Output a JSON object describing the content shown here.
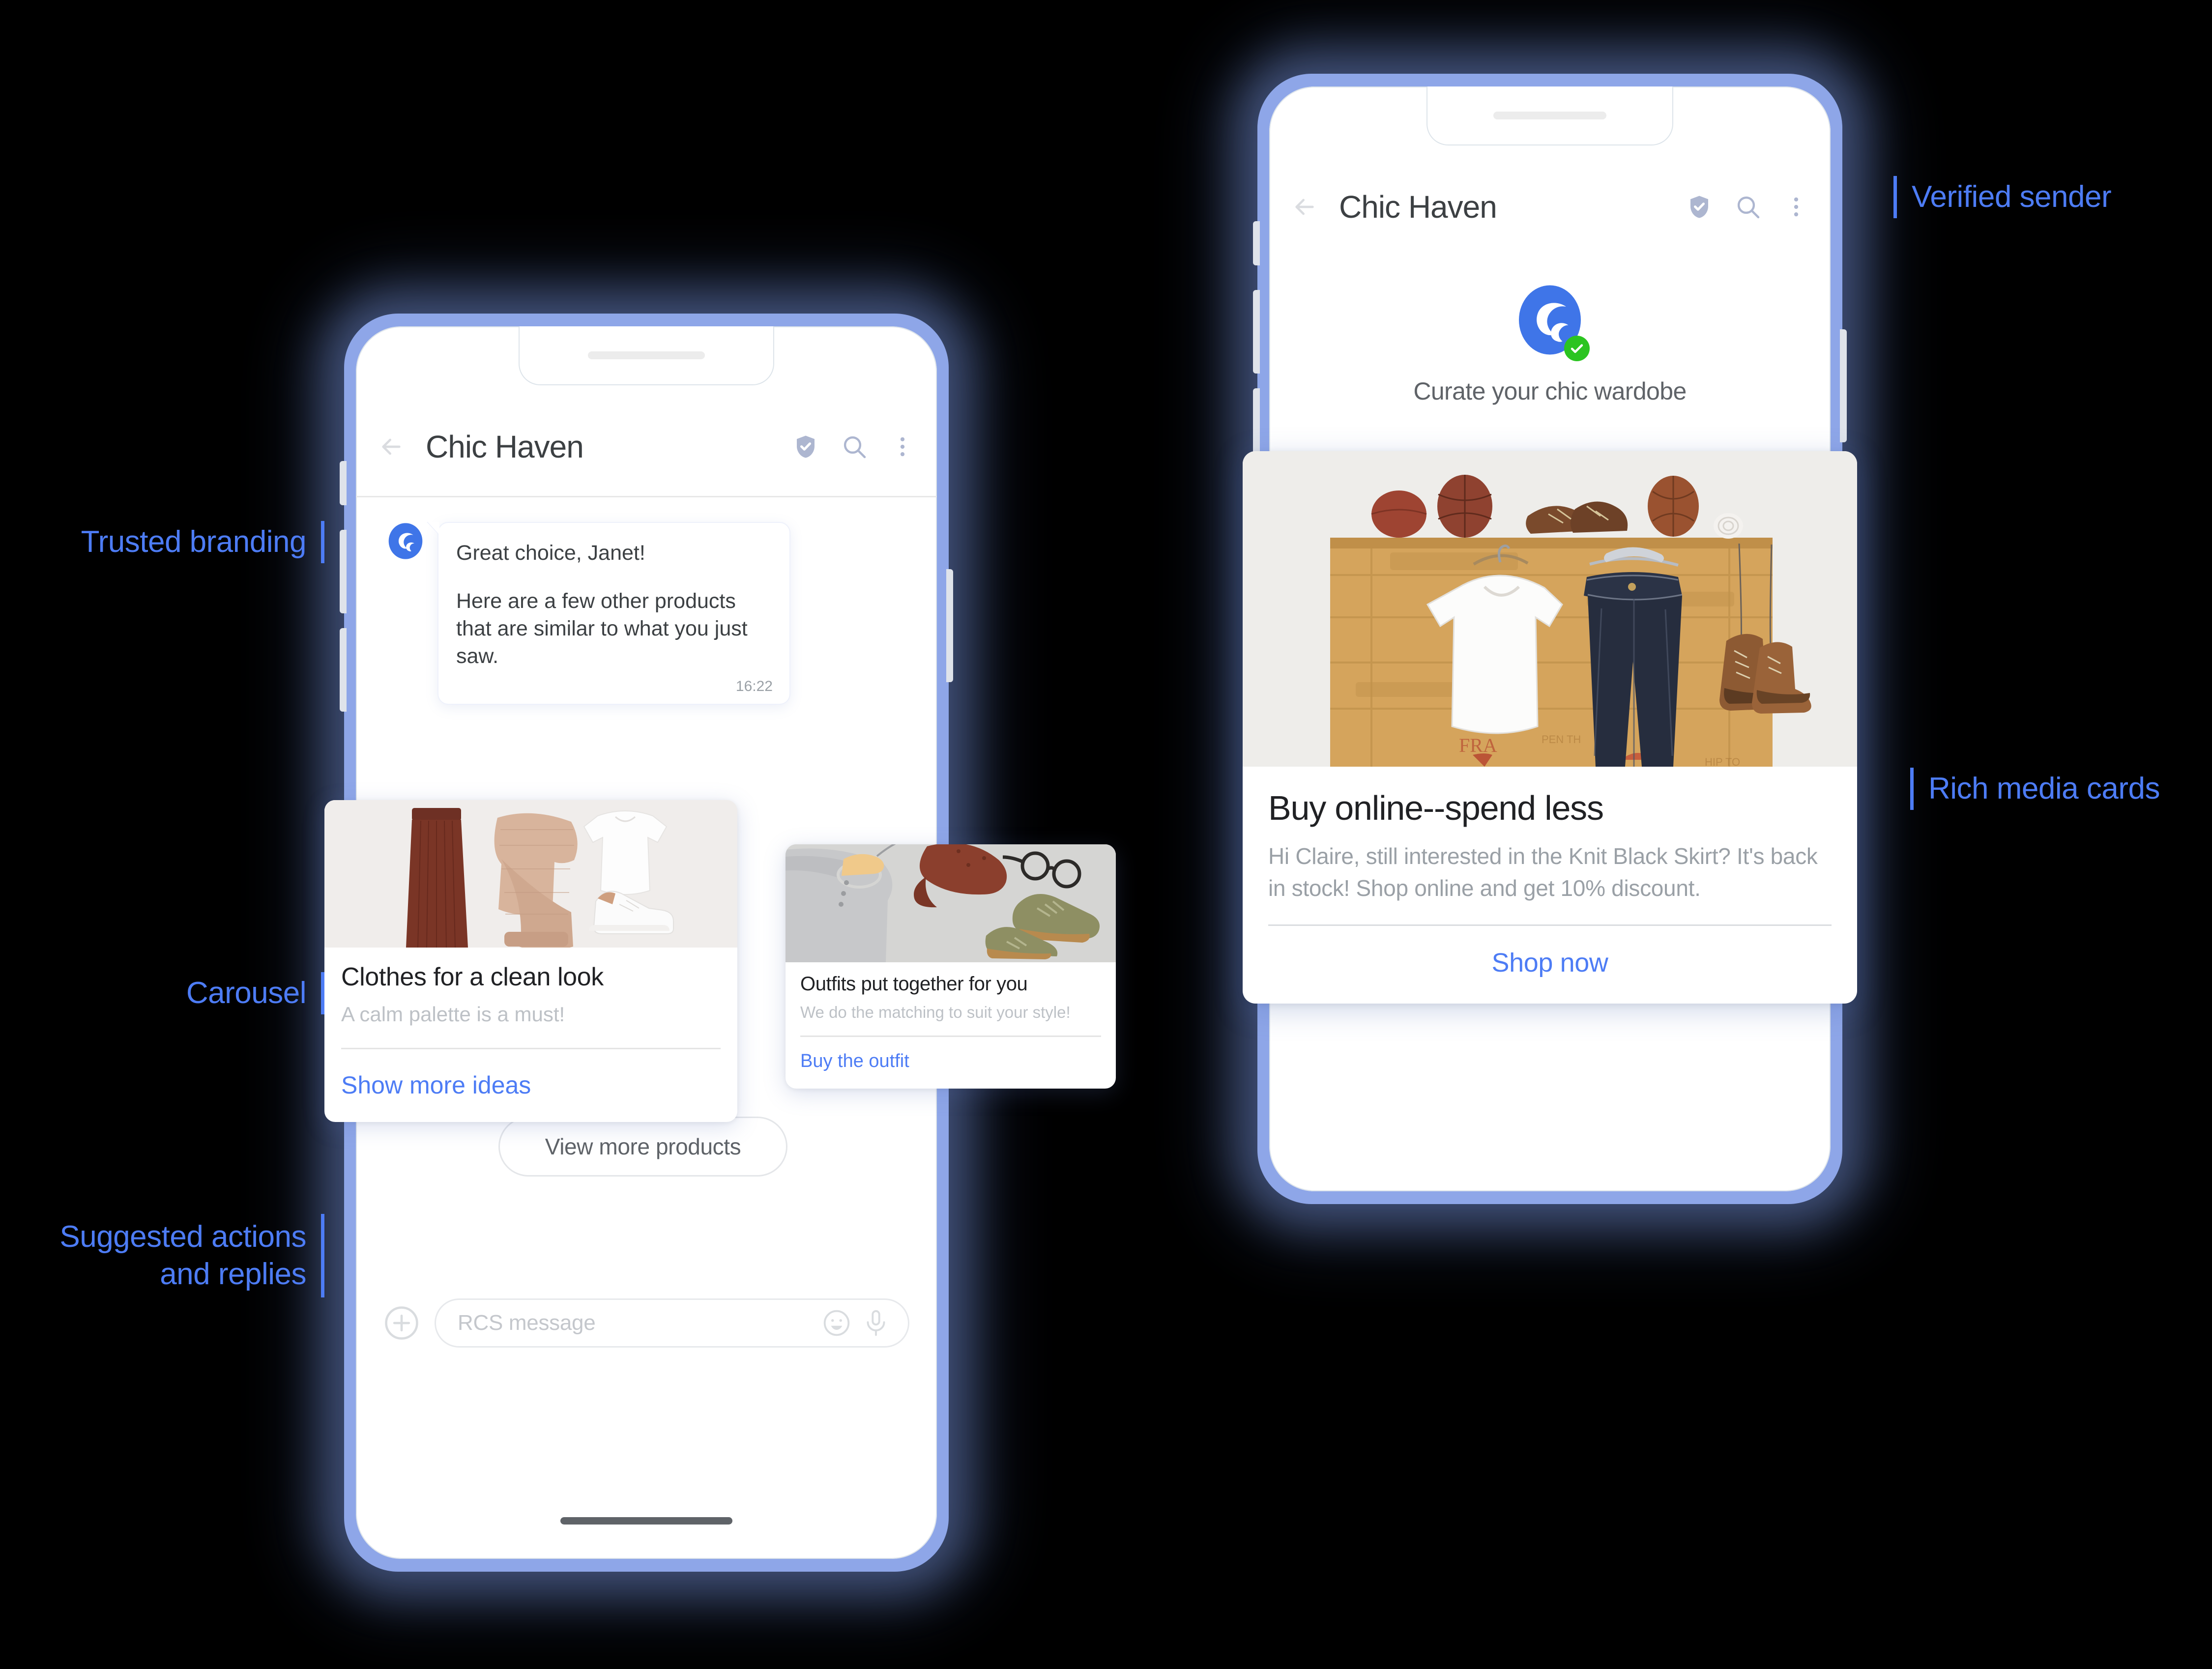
{
  "brand": {
    "accent": "#4d7cf5",
    "frame_color": "#8ea6e8",
    "verified_green": "#2bc421",
    "logo_name": "chic-haven-logo"
  },
  "annotations": [
    {
      "id": "trusted-branding",
      "label": "Trusted branding",
      "side": "left"
    },
    {
      "id": "carousel",
      "label": "Carousel",
      "side": "left"
    },
    {
      "id": "suggested-actions",
      "label_line1": "Suggested actions",
      "label_line2": "and replies",
      "side": "left"
    },
    {
      "id": "verified-sender",
      "label": "Verified sender",
      "side": "right"
    },
    {
      "id": "rich-media-cards",
      "label": "Rich media cards",
      "side": "right"
    }
  ],
  "phone_left": {
    "header": {
      "title": "Chic Haven",
      "back_icon": "back-arrow-icon",
      "verified_icon": "shield-check-icon",
      "search_icon": "search-icon",
      "overflow_icon": "more-vertical-icon"
    },
    "message": {
      "line1": "Great choice, Janet!",
      "line2": "Here are a few other products that are similar to what you just saw.",
      "time": "16:22"
    },
    "carousel": [
      {
        "title": "Clothes for a clean look",
        "subtitle": "A calm palette is a must!",
        "action": "Show more ideas",
        "image_alt": "flat-lay of maroon skirt, beige knit sweater, white tee and white sneaker"
      },
      {
        "title": "Outfits put together for you",
        "subtitle": "We do the matching to suit your style!",
        "action": "Buy the outfit",
        "image_alt": "grey henley on hanger, brown cap, glasses and olive sneakers"
      }
    ],
    "suggested_reply": "View more products",
    "composer": {
      "add_icon": "plus-circle-icon",
      "placeholder": "RCS message",
      "emoji_icon": "emoji-smiley-icon",
      "mic_icon": "microphone-icon"
    }
  },
  "phone_right": {
    "header": {
      "title": "Chic Haven",
      "back_icon": "back-arrow-icon",
      "verified_icon": "shield-check-icon",
      "search_icon": "search-icon",
      "overflow_icon": "more-vertical-icon"
    },
    "welcome": {
      "tagline": "Curate your chic wardobe",
      "verified_badge_icon": "green-check-badge-icon"
    },
    "rich_card": {
      "title": "Buy online--spend less",
      "body": "Hi Claire, still interested in the Knit Black Skirt? It's back in stock! Shop online and get 10% discount.",
      "action": "Shop now",
      "image_alt": "white tee and dark jeans hanging on wooden crate wall with vintage balls and boots"
    }
  }
}
